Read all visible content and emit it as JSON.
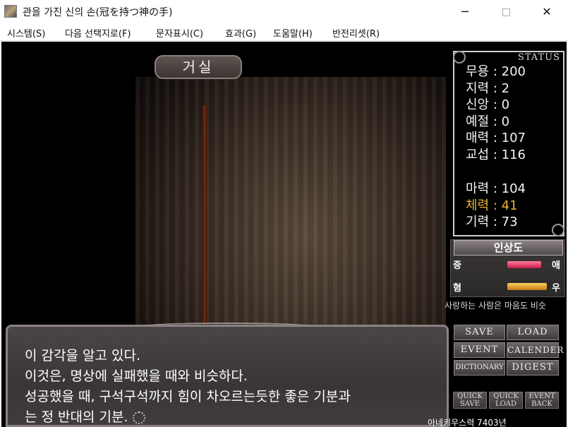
{
  "window": {
    "title": "관을 가진 신의 손(冠を持つ神の手)",
    "minimize_glyph": "─",
    "close_glyph": "✕"
  },
  "menu": [
    {
      "label": "시스템(S)"
    },
    {
      "label": "다음 선택지로(F)"
    },
    {
      "label": "문자표시(C)"
    },
    {
      "label": "효과(G)"
    },
    {
      "label": "도움말(H)"
    },
    {
      "label": "반전리셋(R)"
    }
  ],
  "location": "거실",
  "status": {
    "header": "STATUS",
    "stats": [
      {
        "label": "무용 : 200"
      },
      {
        "label": "지력 : 2"
      },
      {
        "label": "신앙 : 0"
      },
      {
        "label": "예절 : 0"
      },
      {
        "label": "매력 : 107"
      },
      {
        "label": "교섭 : 116"
      },
      {
        "label": "마력 : 104"
      },
      {
        "label": "체력 : 41"
      },
      {
        "label": "기력 : 73"
      }
    ]
  },
  "affinity": {
    "title": "인상도",
    "rows": [
      {
        "left": "증",
        "right": "애",
        "color": "#e0305a"
      },
      {
        "left": "혐",
        "right": "우",
        "color": "#e6a020"
      }
    ],
    "caption": "사랑하는 사람은 마음도 비슷"
  },
  "dialog": {
    "lines": [
      "이 감각을 알고 있다.",
      "이것은, 명상에 실패했을 때와 비슷하다.",
      "성공했을 때, 구석구석까지 힘이 차오르는듯한 좋은 기분과",
      "는 정 반대의 기분."
    ]
  },
  "system_buttons": {
    "save": "SAVE",
    "load": "LOAD",
    "event": "EVENT",
    "calender": "CALENDER",
    "dictionary": "DICTIONARY",
    "digest": "DIGEST",
    "quick_save_1": "QUICK",
    "quick_save_2": "SAVE",
    "quick_load_1": "QUICK",
    "quick_load_2": "LOAD",
    "event_back_1": "EVENT",
    "event_back_2": "BACK"
  },
  "date": "아네키우스력 7403년"
}
